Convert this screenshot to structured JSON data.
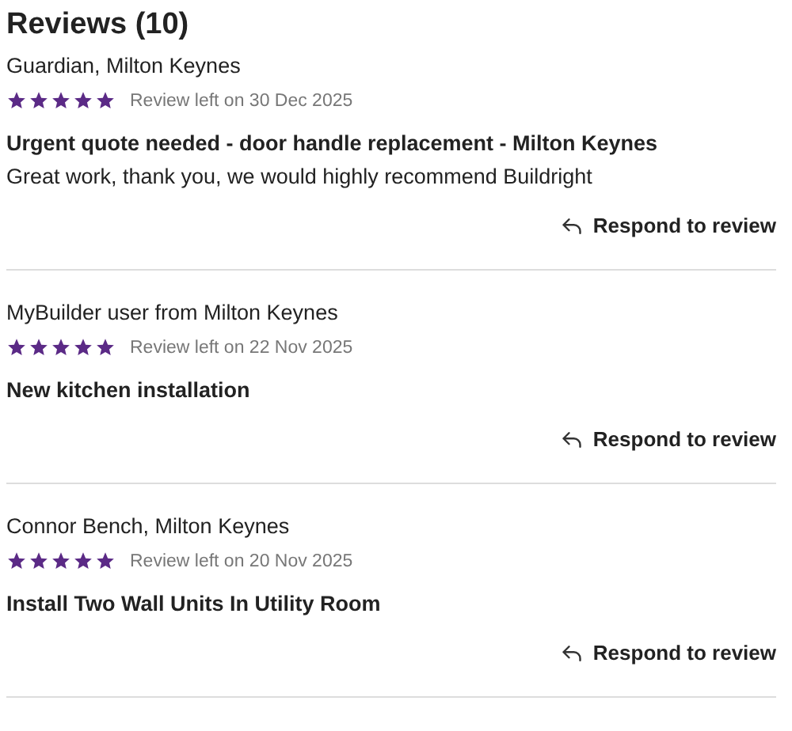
{
  "title": "Reviews (10)",
  "reviews": [
    {
      "author": "Guardian, Milton Keynes",
      "stars": 5,
      "date": "Review left on 30 Dec 2025",
      "heading": "Urgent quote needed - door handle replacement - Milton Keynes",
      "body": "Great work, thank you, we would highly recommend Buildright",
      "action": "Respond to review"
    },
    {
      "author": "MyBuilder user from Milton Keynes",
      "stars": 5,
      "date": "Review left on 22 Nov 2025",
      "heading": "New kitchen installation",
      "action": "Respond to review"
    },
    {
      "author": "Connor Bench, Milton Keynes",
      "stars": 5,
      "date": "Review left on 20 Nov 2025",
      "heading": "Install Two Wall Units In Utility Room",
      "action": "Respond to review"
    }
  ]
}
